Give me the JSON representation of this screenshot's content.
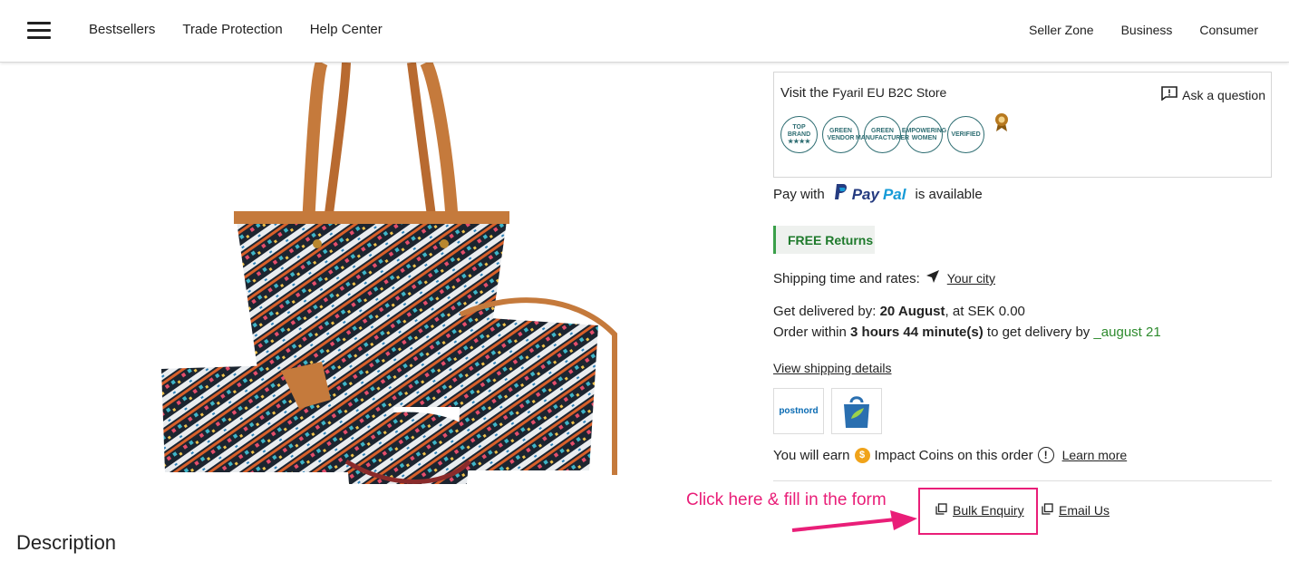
{
  "nav": {
    "left": [
      "Bestsellers",
      "Trade Protection",
      "Help Center"
    ],
    "right": [
      "Seller Zone",
      "Business",
      "Consumer"
    ]
  },
  "store": {
    "visit_prefix": "Visit the",
    "store_name": "Fyaril EU B2C Store",
    "ask_label": "Ask a question",
    "badges": [
      "TOP BRAND ★★★★",
      "GREEN VENDOR",
      "GREEN MANUFACTURER",
      "EMPOWERING WOMEN",
      "VERIFIED"
    ]
  },
  "payment": {
    "prefix": "Pay with",
    "brand_pay": "Pay",
    "brand_pal": "Pal",
    "suffix": "is available"
  },
  "returns": {
    "label": "FREE Returns"
  },
  "shipping": {
    "label": "Shipping time and rates:",
    "city": "Your city",
    "view_details": "View shipping details"
  },
  "delivery": {
    "line1_prefix": "Get delivered by: ",
    "line1_date": "20 August",
    "line1_suffix": ", at SEK 0.00",
    "line2_prefix": "Order within ",
    "line2_time": "3 hours 44 minute(s)",
    "line2_mid": " to get delivery by ",
    "line2_date": "_august 21"
  },
  "carriers": {
    "postnord": "postnord"
  },
  "coins": {
    "prefix": "You will earn",
    "coin_symbol": "$",
    "suffix": "Impact Coins on this order",
    "info_symbol": "!",
    "learn_more": "Learn more"
  },
  "annotation": {
    "text": "Click here & fill in the form"
  },
  "actions": {
    "bulk_enquiry": "Bulk Enquiry",
    "email_us": "Email Us"
  },
  "description": {
    "title": "Description"
  },
  "colors": {
    "annotation_pink": "#e91e78",
    "returns_green": "#1f7a2c",
    "badge_teal": "#2f6e73",
    "paypal_dark": "#253b80",
    "paypal_light": "#179bd7"
  }
}
